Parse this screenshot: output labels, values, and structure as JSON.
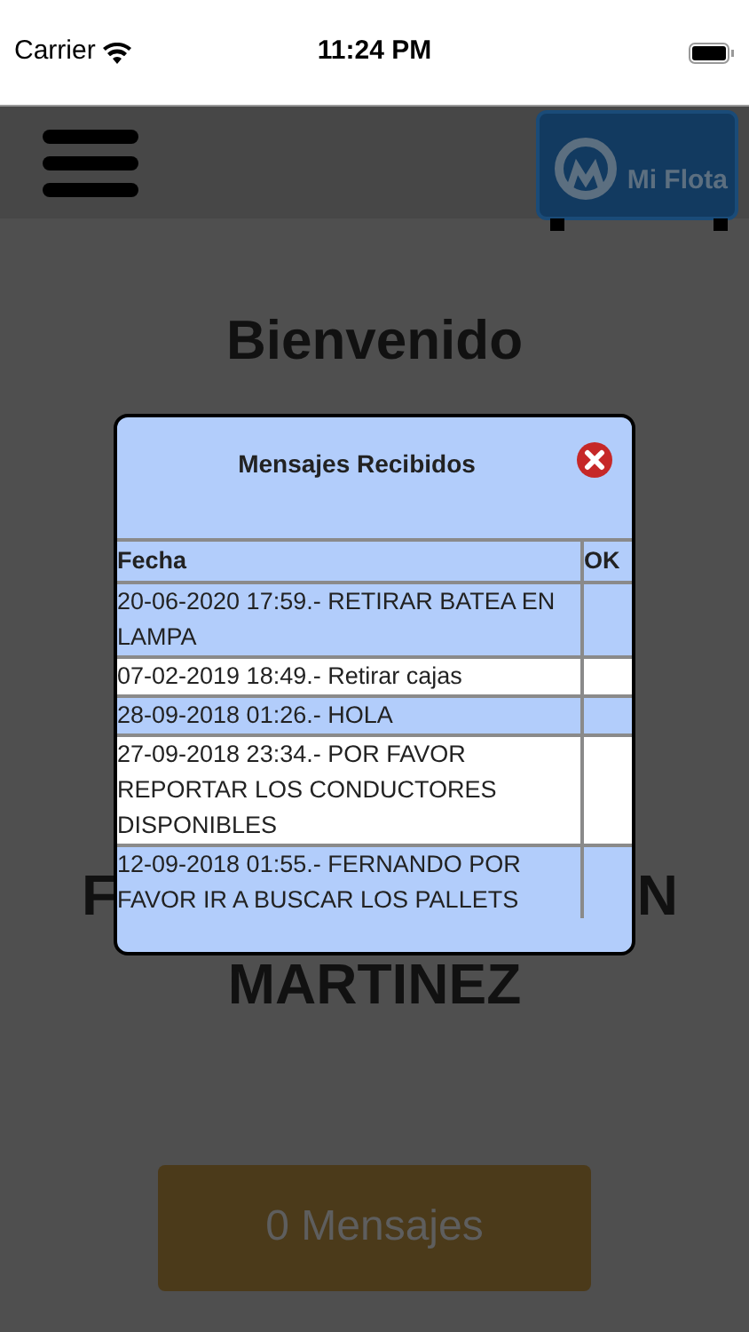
{
  "status_bar": {
    "carrier": "Carrier",
    "time": "11:24 PM"
  },
  "header": {
    "logo_text": "Mi Flota"
  },
  "welcome": "Bienvenido",
  "name_fragments": [
    "F",
    "N"
  ],
  "name_line_2": "MARTINEZ",
  "messages_button": "0 Mensajes",
  "dialog": {
    "title": "Mensajes Recibidos",
    "columns": [
      "Fecha",
      "OK"
    ],
    "rows": [
      {
        "text": "20-06-2020 17:59.- RETIRAR BATEA EN LAMPA"
      },
      {
        "text": "07-02-2019 18:49.- Retirar cajas"
      },
      {
        "text": "28-09-2018 01:26.- HOLA"
      },
      {
        "text": "27-09-2018 23:34.- POR FAVOR REPORTAR LOS CONDUCTORES DISPONIBLES"
      },
      {
        "text": "12-09-2018 01:55.- FERNANDO POR FAVOR IR A BUSCAR LOS PALLETS"
      }
    ]
  }
}
